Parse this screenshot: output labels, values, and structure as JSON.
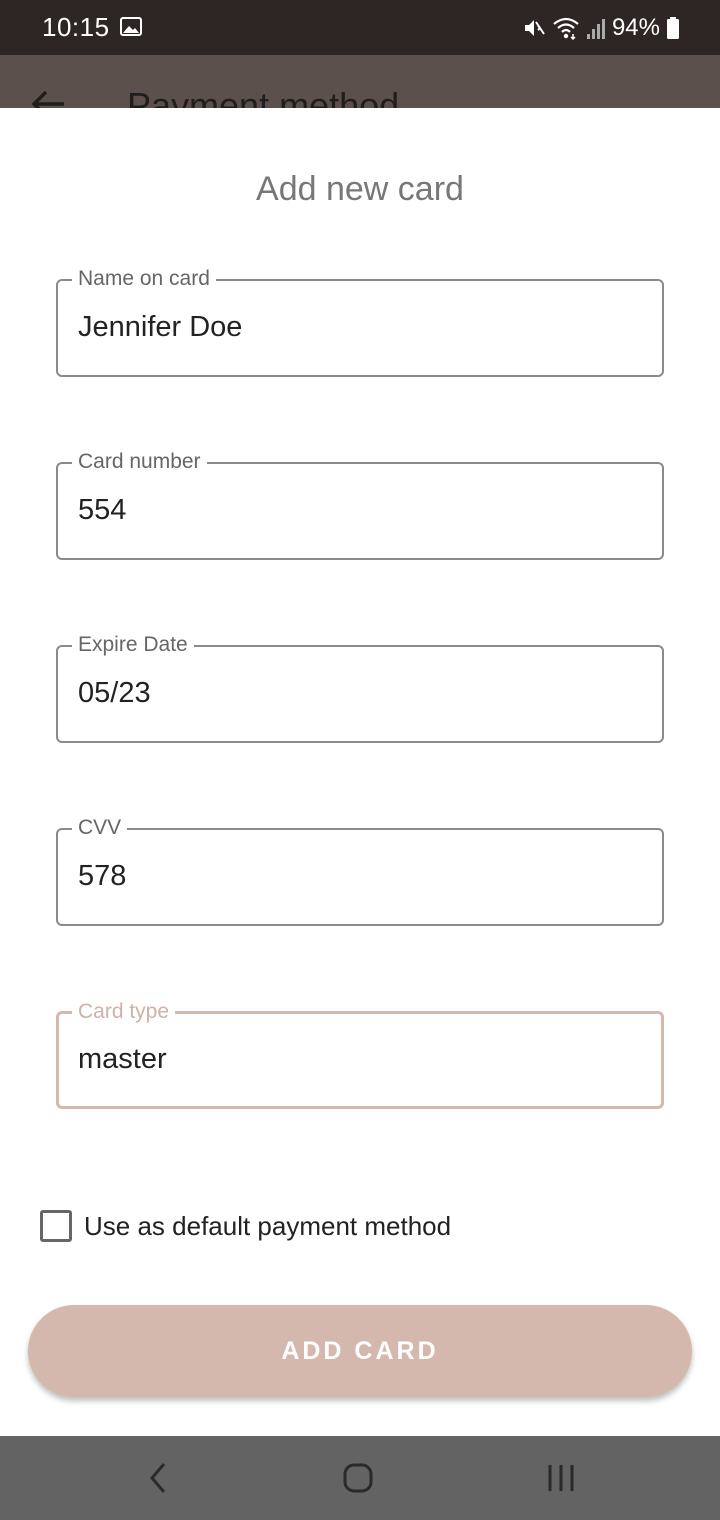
{
  "status_bar": {
    "time": "10:15",
    "battery_percent": "94%",
    "icons": [
      "image-icon",
      "mute-icon",
      "wifi-icon",
      "signal-icon",
      "battery-icon"
    ]
  },
  "app_bar": {
    "title": "Payment method",
    "back_icon": "arrow-left-icon"
  },
  "sheet": {
    "title": "Add new card",
    "fields": [
      {
        "label": "Name on card",
        "value": "Jennifer Doe"
      },
      {
        "label": "Card number",
        "value": "554"
      },
      {
        "label": "Expire Date",
        "value": "05/23"
      },
      {
        "label": "CVV",
        "value": "578"
      },
      {
        "label": "Card type",
        "value": "master"
      }
    ],
    "default_checkbox": {
      "label": "Use as default payment method",
      "checked": false
    },
    "add_button_label": "ADD CARD"
  },
  "nav_bar": {
    "icons": [
      "back-chevron-icon",
      "home-icon",
      "recents-icon"
    ]
  },
  "colors": {
    "status_bar": "#2e2624",
    "accent": "#d4b8ae",
    "nav_bar": "#636363"
  }
}
